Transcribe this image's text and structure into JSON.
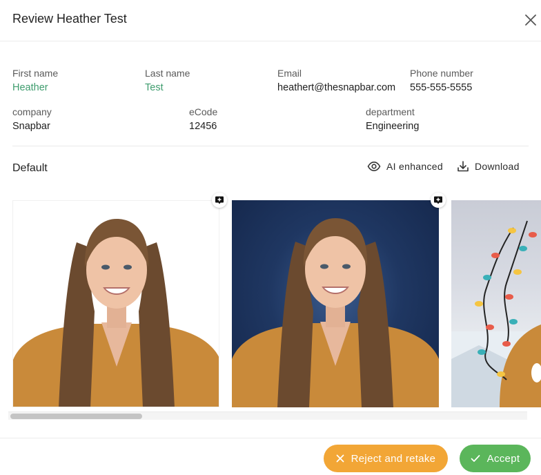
{
  "header": {
    "title": "Review Heather Test"
  },
  "fields": {
    "first_name": {
      "label": "First name",
      "value": "Heather"
    },
    "last_name": {
      "label": "Last name",
      "value": "Test"
    },
    "email": {
      "label": "Email",
      "value": "heathert@thesnapbar.com"
    },
    "phone": {
      "label": "Phone number",
      "value": "555-555-5555"
    },
    "company": {
      "label": "company",
      "value": "Snapbar"
    },
    "ecode": {
      "label": "eCode",
      "value": "12456"
    },
    "department": {
      "label": "department",
      "value": "Engineering"
    }
  },
  "section": {
    "title": "Default",
    "ai_enhanced_label": "AI enhanced",
    "download_label": "Download"
  },
  "photos": [
    {
      "background": "white"
    },
    {
      "background": "navy-studio"
    },
    {
      "background": "holiday-lights"
    }
  ],
  "footer": {
    "reject_label": "Reject and retake",
    "accept_label": "Accept"
  },
  "colors": {
    "accent_green_text": "#3e9c6d",
    "reject_orange": "#f2a636",
    "accept_green": "#5bb65b"
  }
}
